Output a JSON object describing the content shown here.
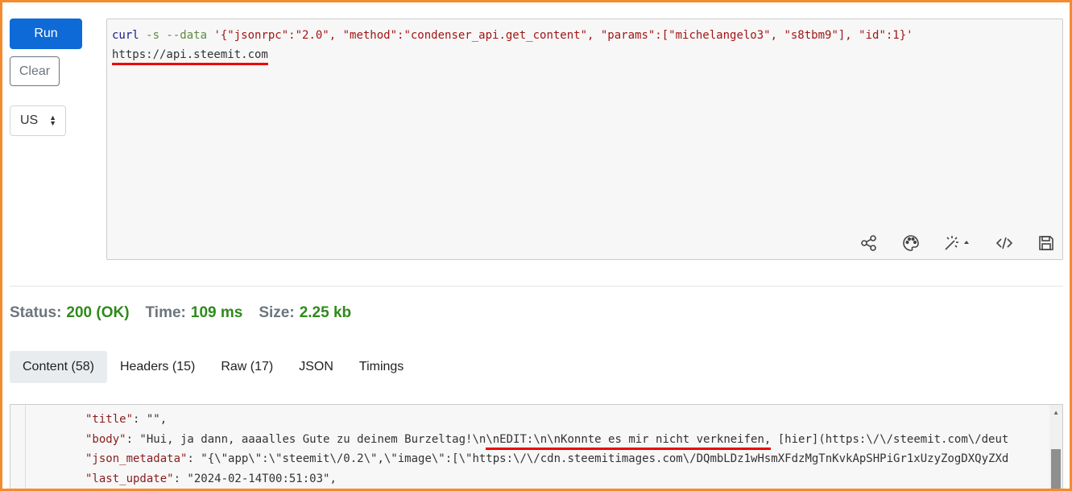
{
  "controls": {
    "run_label": "Run",
    "clear_label": "Clear",
    "region_value": "US"
  },
  "editor": {
    "cmd": "curl",
    "flags": " -s --data ",
    "payload": "'{\"jsonrpc\":\"2.0\", \"method\":\"condenser_api.get_content\", \"params\":[\"michelangelo3\", \"s8tbm9\"], \"id\":1}'",
    "url": "https://api.steemit.com",
    "toolbar_icons": [
      "share-icon",
      "palette-icon",
      "magic-wand-icon",
      "code-icon",
      "save-icon"
    ]
  },
  "status": {
    "status_label": "Status:",
    "status_value": "200 (OK)",
    "time_label": "Time:",
    "time_value": "109 ms",
    "size_label": "Size:",
    "size_value": "2.25 kb"
  },
  "tabs": [
    {
      "label": "Content (58)"
    },
    {
      "label": "Headers (15)"
    },
    {
      "label": "Raw (17)"
    },
    {
      "label": "JSON"
    },
    {
      "label": "Timings"
    }
  ],
  "output": {
    "line1_key": "\"title\"",
    "line1_rest": ": \"\",",
    "line2_key": "\"body\"",
    "line2_pre": ": \"Hui, ja dann, aaaalles Gute zu deinem Burzeltag!\\n",
    "line2_mark": "\\nEDIT:\\n\\nKonnte es mir nicht verkneifen,",
    "line2_post": " [hier](https:\\/\\/steemit.com\\/deut",
    "line3_key": "\"json_metadata\"",
    "line3_rest": ": \"{\\\"app\\\":\\\"steemit\\/0.2\\\",\\\"image\\\":[\\\"https:\\/\\/cdn.steemitimages.com\\/DQmbLDz1wHsmXFdzMgTnKvkApSHPiGr1xUzyZogDXQyZXd",
    "line4_key": "\"last_update\"",
    "line4_rest": ": \"2024-02-14T00:51:03\","
  },
  "colors": {
    "accent": "#0d6ad6",
    "frame": "#f58a2f",
    "ok": "#2e8b1a",
    "highlight": "#e00000"
  }
}
